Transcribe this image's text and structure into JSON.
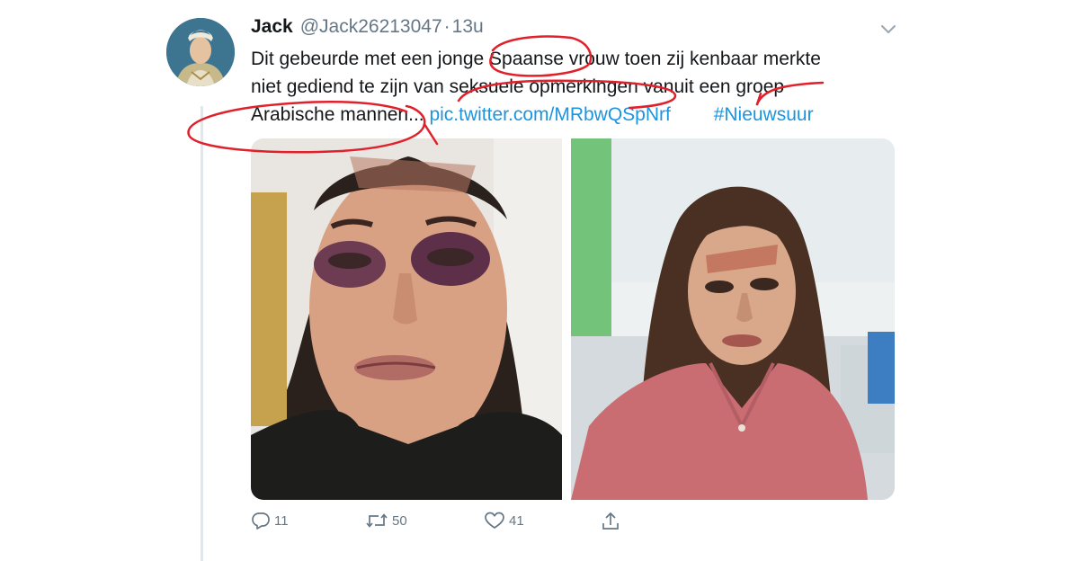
{
  "tweet": {
    "display_name": "Jack",
    "handle": "@Jack26213047",
    "separator": "·",
    "time": "13u",
    "text_lines": [
      "Dit gebeurde met een jonge Spaanse vrouw toen zij kenbaar merkte",
      "niet gediend te zijn van seksuele opmerkingen vanuit een groep"
    ],
    "text_line3": "Arabische mannen...",
    "link": "pic.twitter.com/MRbwQSpNrf",
    "hashtag": "#Nieuwsuur"
  },
  "actions": {
    "reply_count": "11",
    "retweet_count": "50",
    "like_count": "41"
  },
  "icons": {
    "caret": "chevron-down-icon",
    "reply": "reply-icon",
    "retweet": "retweet-icon",
    "like": "heart-icon",
    "share": "share-icon"
  },
  "colors": {
    "link": "#1b95e0",
    "muted": "#657786",
    "annotation": "#e0202a"
  }
}
